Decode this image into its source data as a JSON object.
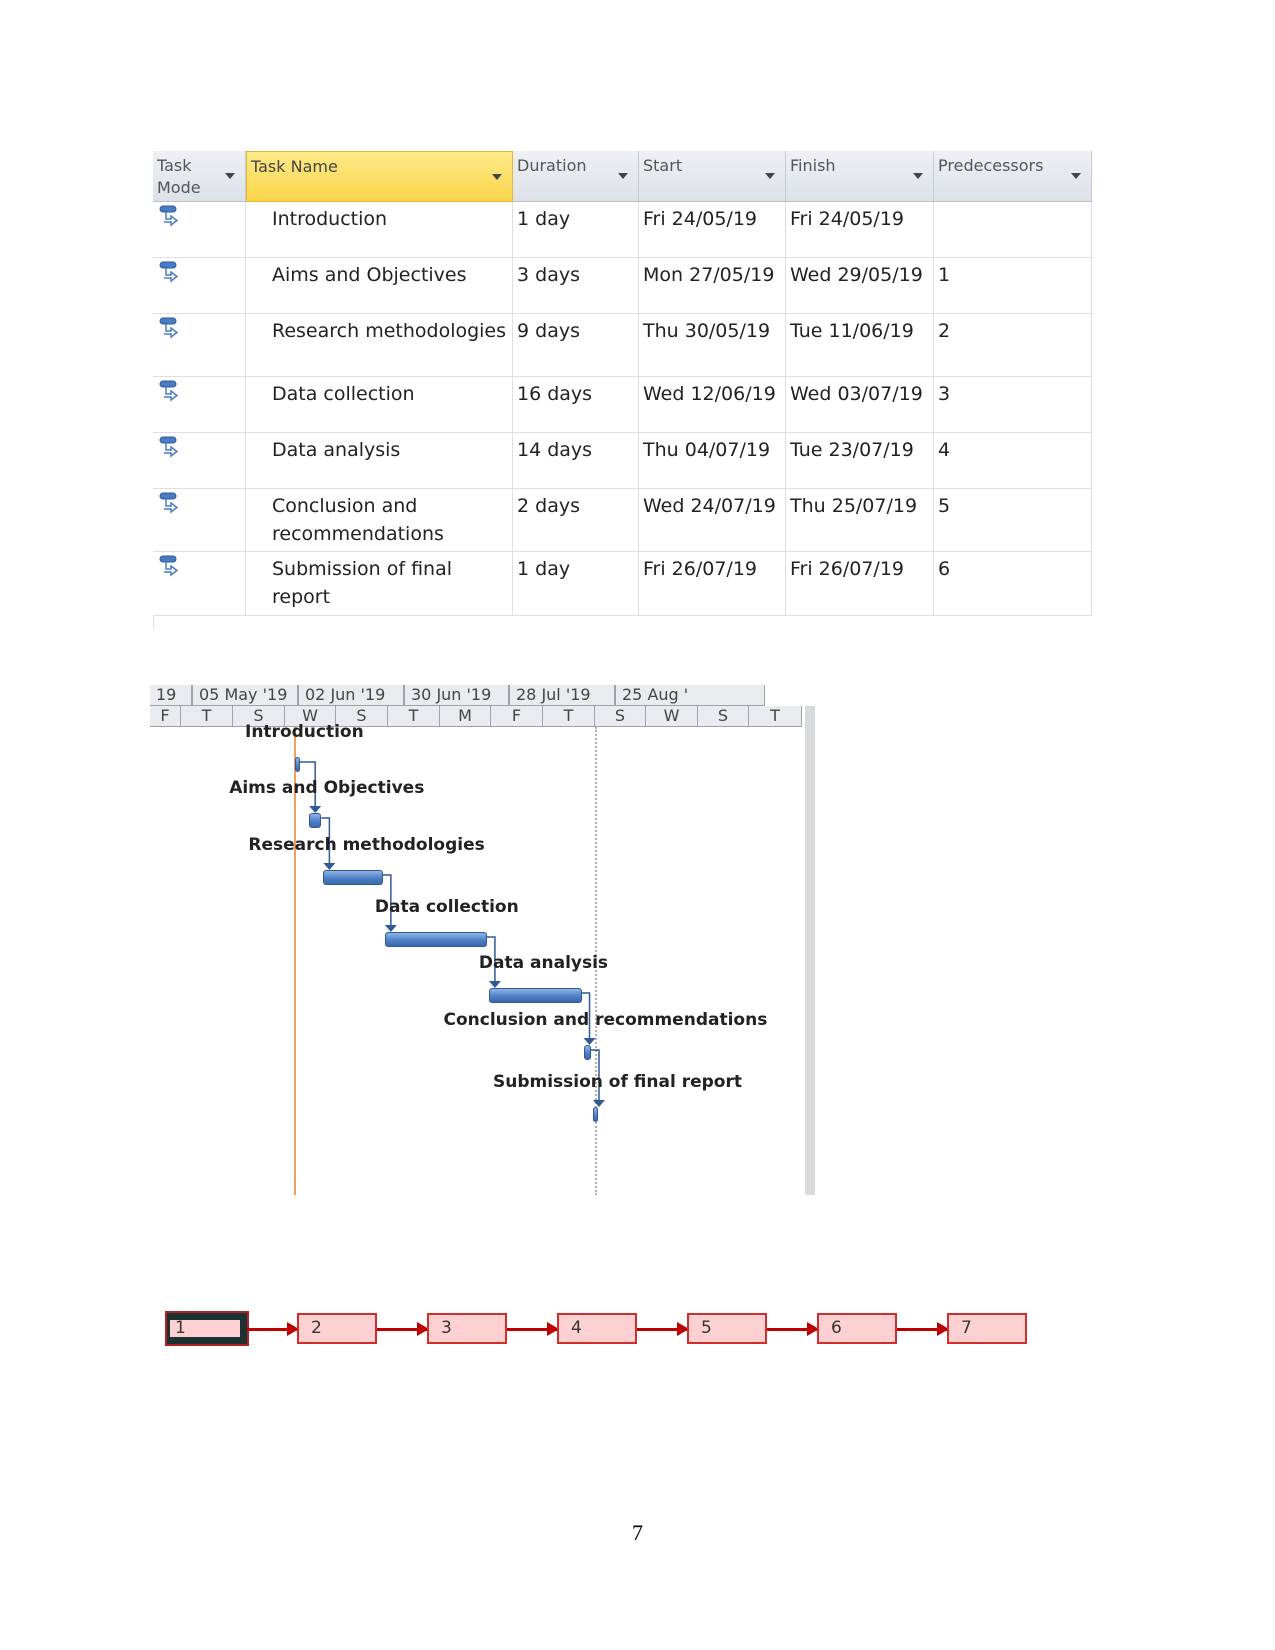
{
  "table": {
    "columns": [
      "Task Mode",
      "Task Name",
      "Duration",
      "Start",
      "Finish",
      "Predecessors"
    ],
    "rows": [
      {
        "name": "Introduction",
        "duration": "1 day",
        "start": "Fri 24/05/19",
        "finish": "Fri 24/05/19",
        "predecessors": ""
      },
      {
        "name": "Aims and Objectives",
        "duration": "3 days",
        "start": "Mon 27/05/19",
        "finish": "Wed 29/05/19",
        "predecessors": "1"
      },
      {
        "name": "Research methodologies",
        "duration": "9 days",
        "start": "Thu 30/05/19",
        "finish": "Tue 11/06/19",
        "predecessors": "2"
      },
      {
        "name": "Data collection",
        "duration": "16 days",
        "start": "Wed 12/06/19",
        "finish": "Wed 03/07/19",
        "predecessors": "3"
      },
      {
        "name": "Data analysis",
        "duration": "14 days",
        "start": "Thu 04/07/19",
        "finish": "Tue 23/07/19",
        "predecessors": "4"
      },
      {
        "name": "Conclusion and recommendations",
        "duration": "2 days",
        "start": "Wed 24/07/19",
        "finish": "Thu 25/07/19",
        "predecessors": "5"
      },
      {
        "name": "Submission of final report",
        "duration": "1 day",
        "start": "Fri 26/07/19",
        "finish": "Fri 26/07/19",
        "predecessors": "6"
      }
    ],
    "task_mode_icon": "auto-scheduled-task-icon"
  },
  "gantt": {
    "timescale_top": [
      "19",
      "05 May '19",
      "02 Jun '19",
      "30 Jun '19",
      "28 Jul '19",
      "25 Aug '"
    ],
    "timescale_bottom": [
      "F",
      "T",
      "S",
      "W",
      "S",
      "T",
      "M",
      "F",
      "T",
      "S",
      "W",
      "S",
      "T"
    ],
    "bars": [
      {
        "label": "Introduction",
        "start": "2019-05-24",
        "finish": "2019-05-24"
      },
      {
        "label": "Aims and Objectives",
        "start": "2019-05-27",
        "finish": "2019-05-29"
      },
      {
        "label": "Research methodologies",
        "start": "2019-05-30",
        "finish": "2019-06-11"
      },
      {
        "label": "Data collection",
        "start": "2019-06-12",
        "finish": "2019-07-03"
      },
      {
        "label": "Data analysis",
        "start": "2019-07-04",
        "finish": "2019-07-23"
      },
      {
        "label": "Conclusion and recommendations",
        "start": "2019-07-24",
        "finish": "2019-07-25"
      },
      {
        "label": "Submission of final report",
        "start": "2019-07-26",
        "finish": "2019-07-26"
      }
    ],
    "bar_color": "#4a7cc4",
    "today_line_color": "#f0a060"
  },
  "network": {
    "nodes": [
      "1",
      "2",
      "3",
      "4",
      "5",
      "6",
      "7"
    ],
    "node_fill": "#fdd1d1",
    "arrow_color": "#c00000"
  },
  "page_number": "7"
}
